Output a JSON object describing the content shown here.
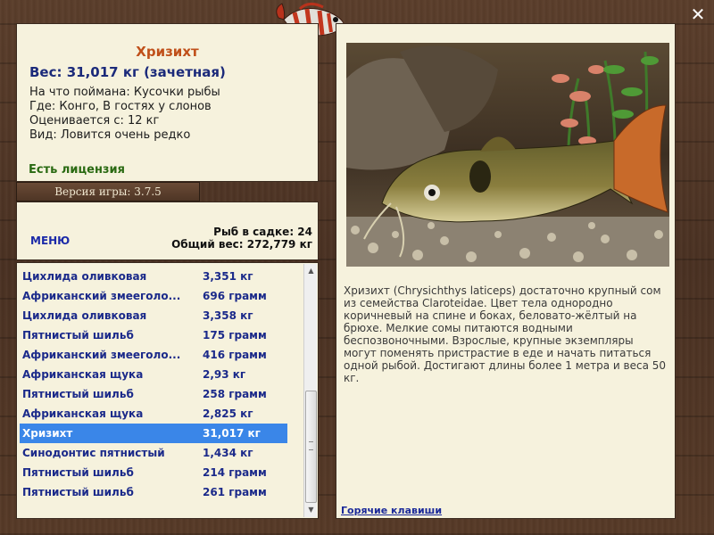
{
  "window": {
    "close_icon": "close-icon"
  },
  "info": {
    "title": "Хризихт",
    "weight": "Вес: 31,017 кг (зачетная)",
    "caught_on": "На что поймана: Кусочки рыбы",
    "location": "Где: Конго, В гостях у слонов",
    "valued_from": "Оценивается с: 12 кг",
    "kind": "Вид: Ловится очень редко",
    "license": "Есть лицензия"
  },
  "version": {
    "label": "Версия игры: 3.7.5"
  },
  "stats": {
    "menu_label": "МЕНЮ",
    "fish_count": "Рыб в садке: 24",
    "total_weight": "Общий вес: 272,779 кг"
  },
  "list": {
    "items": [
      {
        "name": "Цихлида оливковая",
        "weight": "3,351 кг"
      },
      {
        "name": "Африканский змееголо...",
        "weight": "696 грамм"
      },
      {
        "name": "Цихлида оливковая",
        "weight": "3,358 кг"
      },
      {
        "name": "Пятнистый шильб",
        "weight": "175 грамм"
      },
      {
        "name": "Африканский змееголо...",
        "weight": "416 грамм"
      },
      {
        "name": "Африканская щука",
        "weight": "2,93 кг"
      },
      {
        "name": "Пятнистый шильб",
        "weight": "258 грамм"
      },
      {
        "name": "Африканская щука",
        "weight": "2,825 кг"
      },
      {
        "name": "Хризихт",
        "weight": "31,017 кг"
      },
      {
        "name": "Синодонтис пятнистый",
        "weight": "1,434 кг"
      },
      {
        "name": "Пятнистый шильб",
        "weight": "214 грамм"
      },
      {
        "name": "Пятнистый шильб",
        "weight": "261 грамм"
      }
    ],
    "selected_index": 8,
    "scroll_position": 0.55
  },
  "detail": {
    "description": "Хризихт (Chrysichthys laticeps) достаточно крупный сом из семейства Claroteidae. Цвет тела однородно коричневый на спине и боках, беловато-жёлтый на брюхе. Мелкие сомы питаются водными беспозвоночными. Взрослые, крупные экземпляры могут поменять пристрастие в еде и начать питаться одной рыбой. Достигают длины более 1 метра и веса 50 кг.",
    "hotkeys_label": "Горячие клавиши"
  },
  "colors": {
    "title": "#c0501a",
    "weight": "#1b2a7a",
    "license": "#2a6a12",
    "list_text": "#1b2a8a",
    "selection": "#3a86e8",
    "panel_bg": "#f6f2dd"
  }
}
